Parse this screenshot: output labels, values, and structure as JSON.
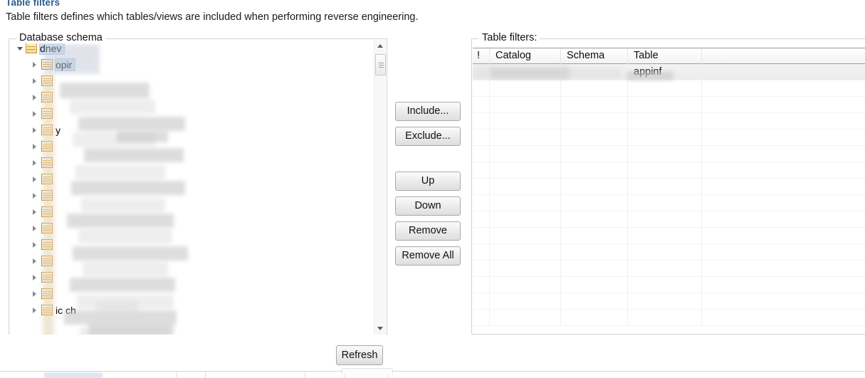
{
  "header": {
    "title": "Table filters",
    "description": "Table filters defines which tables/views are included when performing reverse engineering.",
    "title_color": "#2a5d8f"
  },
  "tree_panel": {
    "label": "Database schema",
    "nodes": [
      {
        "label": "dnev",
        "icon": "database-icon",
        "state": "expanded",
        "selected": true,
        "redacted": true
      },
      {
        "label": "opir",
        "icon": "table-icon",
        "state": "collapsed",
        "selected": true,
        "redacted": true
      },
      {
        "label": "",
        "icon": "table-icon",
        "state": "collapsed",
        "redacted": true
      },
      {
        "label": "",
        "icon": "table-icon",
        "state": "collapsed",
        "redacted": true
      },
      {
        "label": "",
        "icon": "table-icon",
        "state": "collapsed",
        "redacted": true
      },
      {
        "label": "y",
        "icon": "table-icon",
        "state": "collapsed",
        "redacted": true
      },
      {
        "label": "",
        "icon": "table-icon",
        "state": "collapsed",
        "redacted": true
      },
      {
        "label": "",
        "icon": "table-icon",
        "state": "collapsed",
        "redacted": true
      },
      {
        "label": "",
        "icon": "table-icon",
        "state": "collapsed",
        "redacted": true
      },
      {
        "label": "",
        "icon": "table-icon",
        "state": "collapsed",
        "redacted": true
      },
      {
        "label": "",
        "icon": "table-icon",
        "state": "collapsed",
        "redacted": true
      },
      {
        "label": "",
        "icon": "table-icon",
        "state": "collapsed",
        "redacted": true
      },
      {
        "label": "",
        "icon": "table-icon",
        "state": "collapsed",
        "redacted": true
      },
      {
        "label": "",
        "icon": "table-icon",
        "state": "collapsed",
        "redacted": true
      },
      {
        "label": "",
        "icon": "table-icon",
        "state": "collapsed",
        "redacted": true
      },
      {
        "label": "",
        "icon": "table-icon",
        "state": "collapsed",
        "redacted": true
      },
      {
        "label": "ic ch",
        "icon": "table-icon",
        "state": "collapsed",
        "redacted": true
      }
    ],
    "scrollbar": {
      "orientation": "vertical",
      "thumb_position": "near-top"
    }
  },
  "center_buttons": {
    "include_label": "Include...",
    "exclude_label": "Exclude...",
    "up_label": "Up",
    "down_label": "Down",
    "remove_label": "Remove",
    "remove_all_label": "Remove All"
  },
  "filters_panel": {
    "label": "Table filters:",
    "columns": [
      "!",
      "Catalog",
      "Schema",
      "Table",
      ""
    ],
    "rows": [
      {
        "flag": "",
        "catalog": "",
        "schema": "",
        "table": "appinf",
        "redacted": true
      }
    ],
    "empty_row_count": 15
  },
  "footer": {
    "refresh_label": "Refresh"
  }
}
